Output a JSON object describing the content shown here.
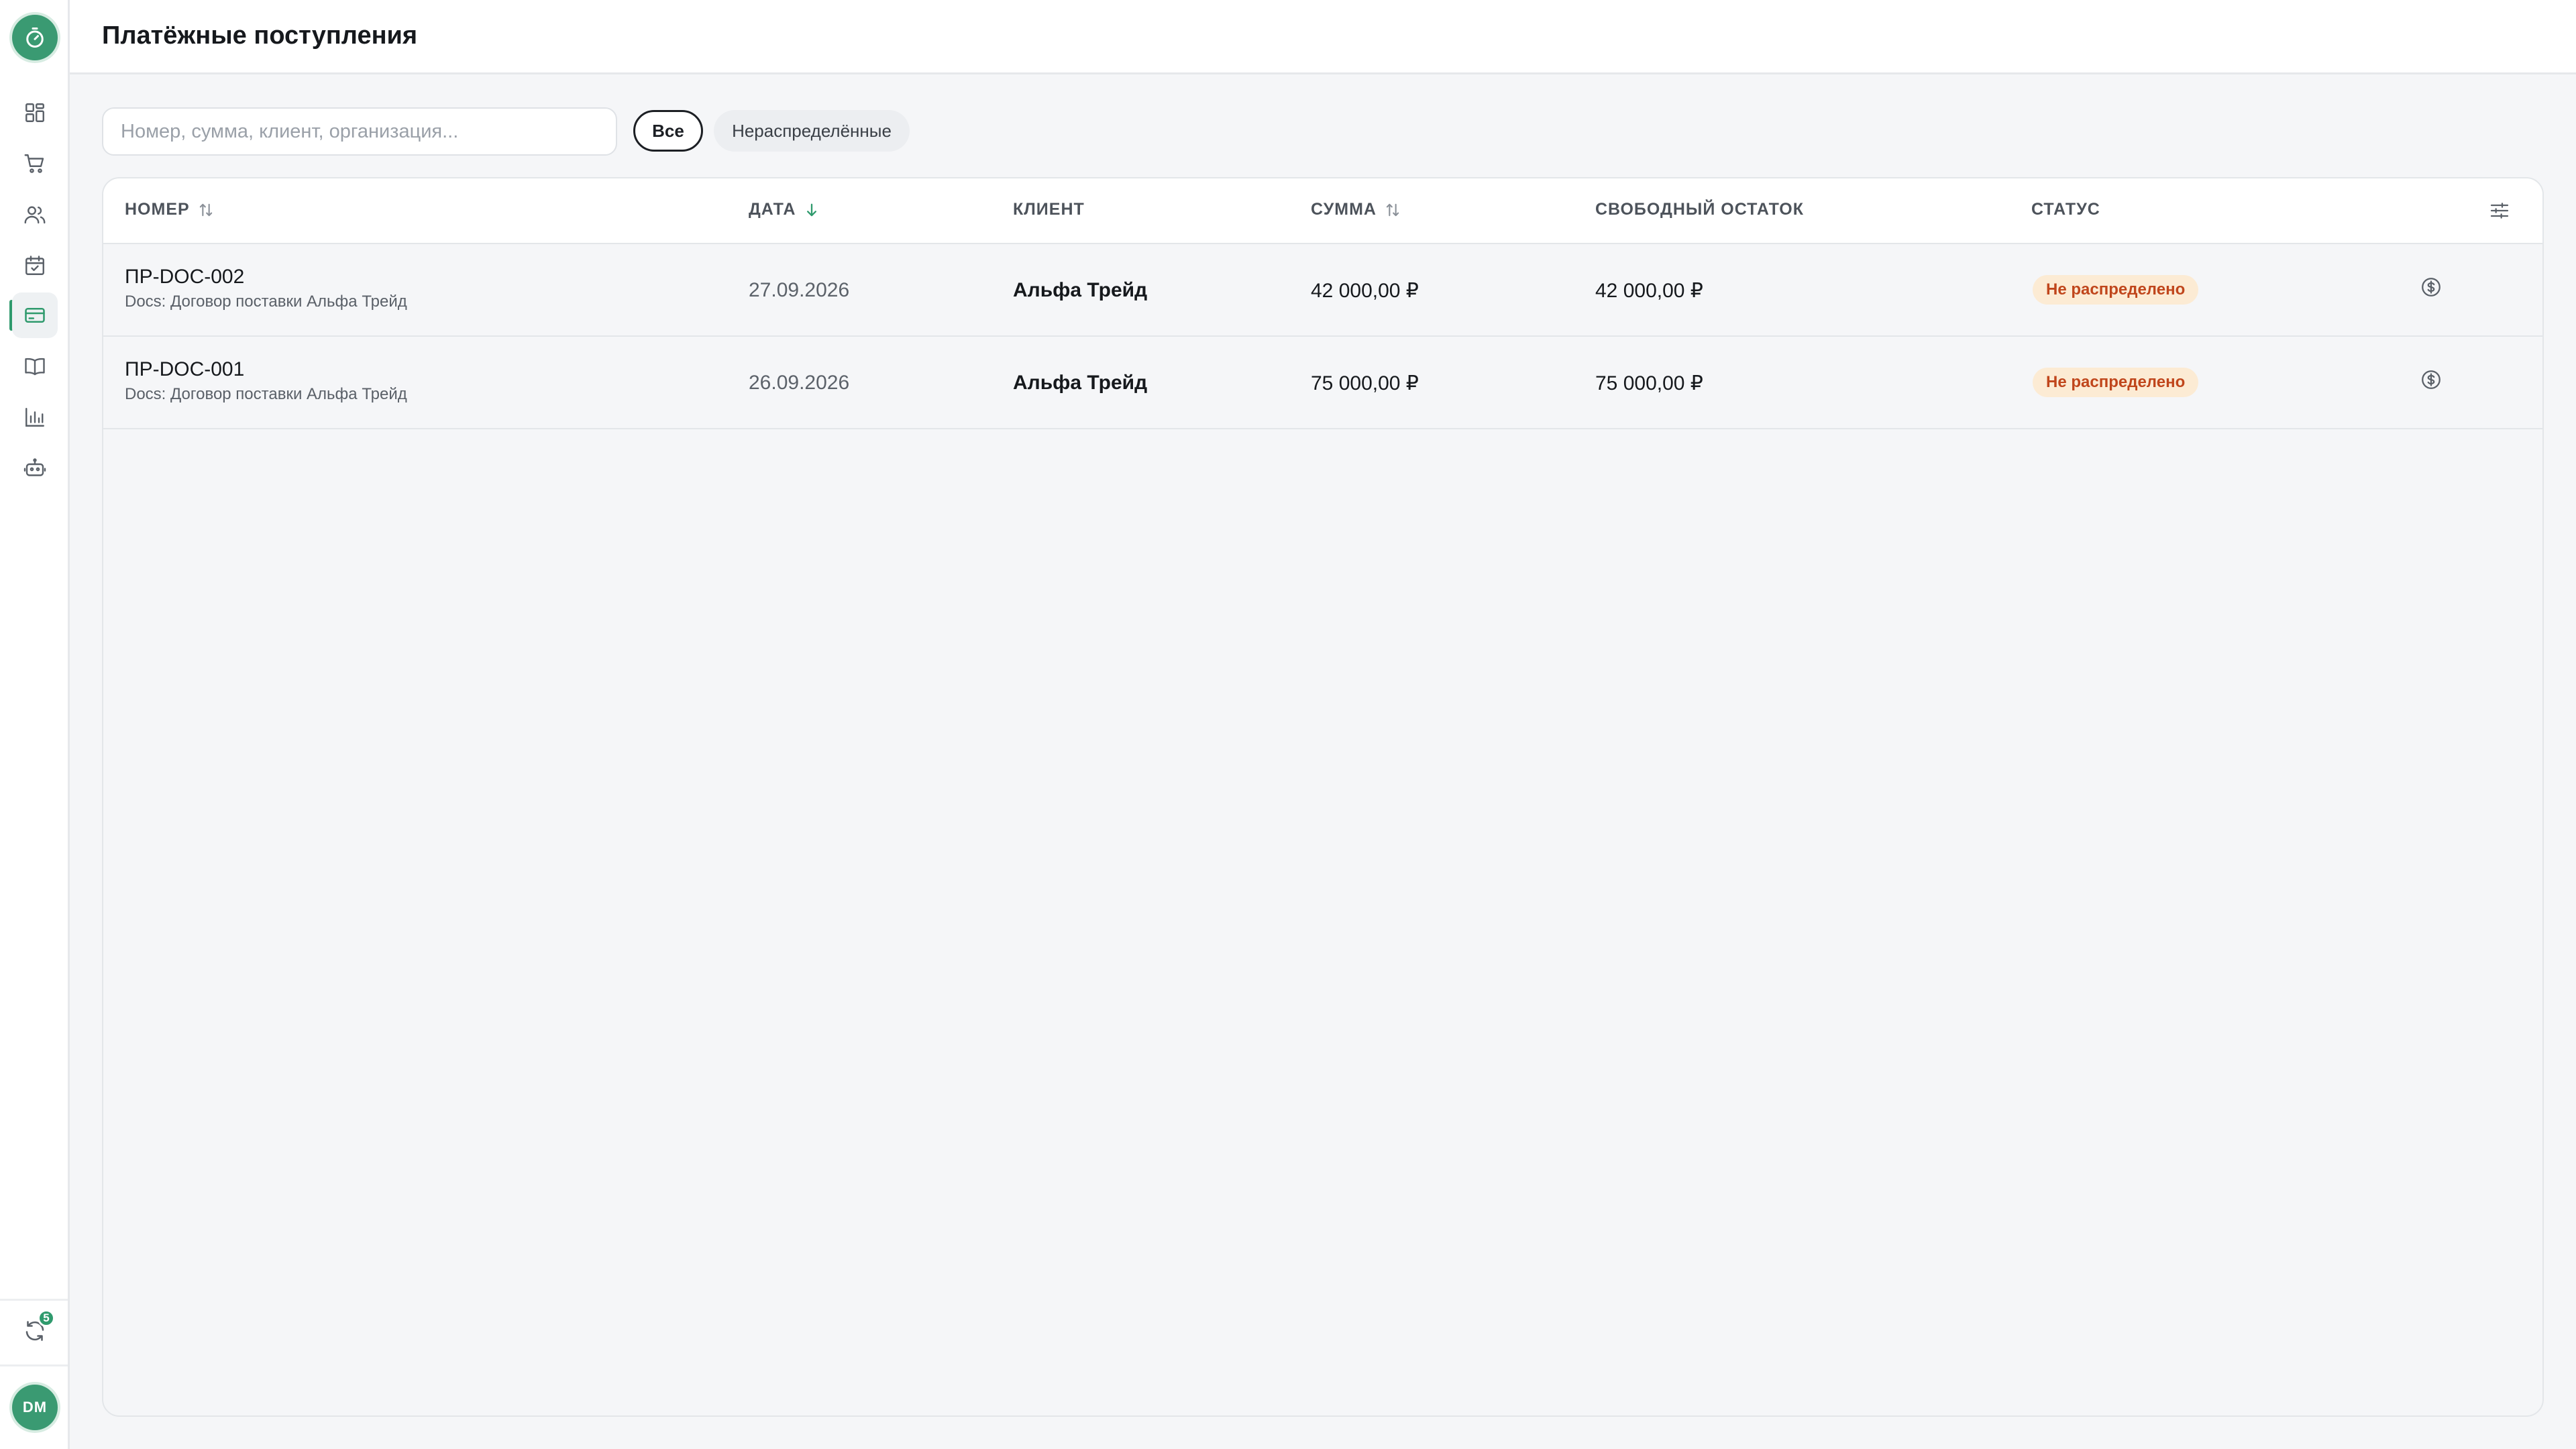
{
  "sidebar": {
    "logo_icon": "stopwatch-icon",
    "items": [
      {
        "id": "dashboard",
        "icon": "dashboard-grid-icon"
      },
      {
        "id": "orders",
        "icon": "cart-icon"
      },
      {
        "id": "clients",
        "icon": "users-icon"
      },
      {
        "id": "calendar",
        "icon": "calendar-check-icon"
      },
      {
        "id": "payments",
        "icon": "credit-card-icon",
        "active": true
      },
      {
        "id": "directory",
        "icon": "book-icon"
      },
      {
        "id": "reports",
        "icon": "bar-chart-icon"
      },
      {
        "id": "bot",
        "icon": "robot-icon"
      }
    ],
    "sync_badge": "5",
    "avatar_initials": "DM"
  },
  "header": {
    "title": "Платёжные поступления"
  },
  "filters": {
    "search_placeholder": "Номер, сумма, клиент, организация...",
    "chip_all": "Все",
    "chip_undistributed": "Нераспределённые",
    "active_chip": "all"
  },
  "table": {
    "columns": {
      "number": "НОМЕР",
      "date": "ДАТА",
      "client": "КЛИЕНТ",
      "amount": "СУММА",
      "free_balance": "СВОБОДНЫЙ ОСТАТОК",
      "status": "СТАТУС"
    },
    "rows": [
      {
        "number": "ПР-DOC-002",
        "sub": "Docs: Договор поставки Альфа Трейд",
        "date": "27.09.2026",
        "client": "Альфа Трейд",
        "amount": "42 000,00 ₽",
        "free_balance": "42 000,00 ₽",
        "status": "Не распределено"
      },
      {
        "number": "ПР-DOC-001",
        "sub": "Docs: Договор поставки Альфа Трейд",
        "date": "26.09.2026",
        "client": "Альфа Трейд",
        "amount": "75 000,00 ₽",
        "free_balance": "75 000,00 ₽",
        "status": "Не распределено"
      }
    ]
  },
  "colors": {
    "accent": "#2f9a6d",
    "status_bg": "#fcebd4",
    "status_text": "#c0461c"
  }
}
